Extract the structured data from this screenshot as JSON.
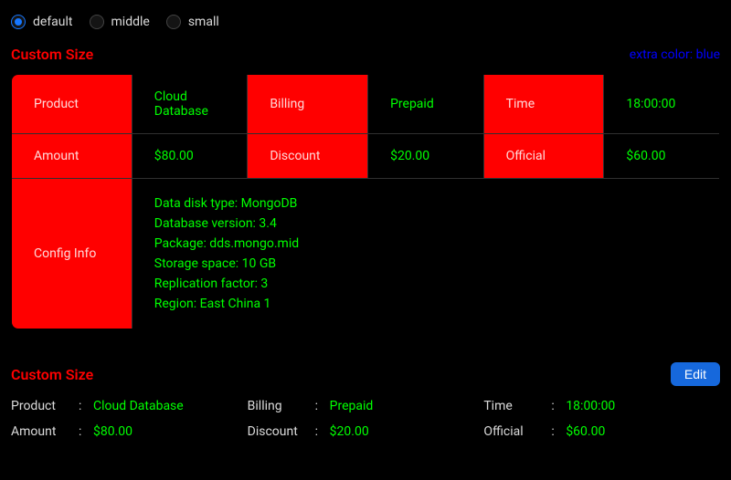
{
  "radios": {
    "options": [
      {
        "value": "default",
        "label": "default",
        "checked": true
      },
      {
        "value": "middle",
        "label": "middle",
        "checked": false
      },
      {
        "value": "small",
        "label": "small",
        "checked": false
      }
    ]
  },
  "descriptions1": {
    "title": "Custom Size",
    "extra": "extra color: blue",
    "rows": [
      [
        {
          "label": "Product",
          "value": "Cloud Database"
        },
        {
          "label": "Billing",
          "value": "Prepaid"
        },
        {
          "label": "Time",
          "value": "18:00:00"
        }
      ],
      [
        {
          "label": "Amount",
          "value": "$80.00"
        },
        {
          "label": "Discount",
          "value": "$20.00"
        },
        {
          "label": "Official",
          "value": "$60.00"
        }
      ]
    ],
    "config": {
      "label": "Config Info",
      "lines": [
        "Data disk type: MongoDB",
        "Database version: 3.4",
        "Package: dds.mongo.mid",
        "Storage space: 10 GB",
        "Replication factor: 3",
        "Region: East China 1"
      ]
    }
  },
  "descriptions2": {
    "title": "Custom Size",
    "edit_label": "Edit",
    "rows": [
      [
        {
          "label": "Product",
          "value": "Cloud Database"
        },
        {
          "label": "Billing",
          "value": "Prepaid"
        },
        {
          "label": "Time",
          "value": "18:00:00"
        }
      ],
      [
        {
          "label": "Amount",
          "value": "$80.00"
        },
        {
          "label": "Discount",
          "value": "$20.00"
        },
        {
          "label": "Official",
          "value": "$60.00"
        }
      ]
    ]
  },
  "colors": {
    "label_bg": "red",
    "content_color": "#00ff00",
    "extra_color": "blue",
    "title_color": "#ff0000",
    "primary": "#1668dc"
  }
}
